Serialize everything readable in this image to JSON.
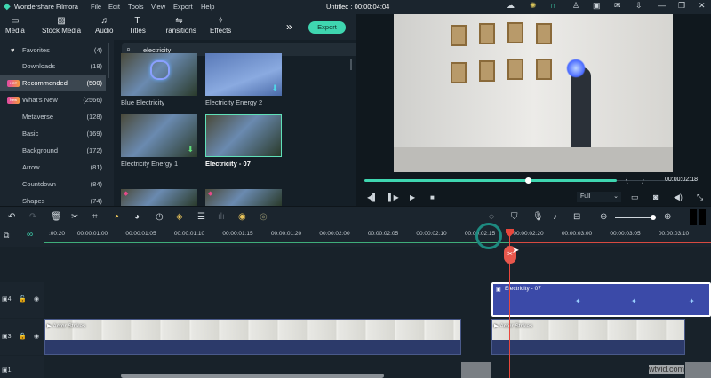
{
  "app": {
    "name": "Wondershare Filmora",
    "title": "Untitled : 00:00:04:04",
    "menu": [
      "File",
      "Edit",
      "Tools",
      "View",
      "Export",
      "Help"
    ]
  },
  "window_icons": [
    "cloud-icon",
    "lightbulb-icon",
    "headset-icon",
    "account-icon",
    "save-icon",
    "mail-icon",
    "download-icon",
    "minimize-icon",
    "restore-icon",
    "close-icon"
  ],
  "toolbar": {
    "tabs": [
      "Media",
      "Stock Media",
      "Audio",
      "Titles",
      "Transitions",
      "Effects"
    ],
    "more": "»",
    "export": "Export"
  },
  "sidebar": {
    "items": [
      {
        "label": "Favorites",
        "count": "(4)",
        "icon": "heart-icon"
      },
      {
        "label": "Downloads",
        "count": "(18)"
      },
      {
        "label": "Recommended",
        "count": "(500)",
        "badge": "HOT",
        "selected": true
      },
      {
        "label": "What's New",
        "count": "(2566)",
        "badge": "New"
      },
      {
        "label": "Metaverse",
        "count": "(128)"
      },
      {
        "label": "Basic",
        "count": "(169)"
      },
      {
        "label": "Background",
        "count": "(172)"
      },
      {
        "label": "Arrow",
        "count": "(81)"
      },
      {
        "label": "Countdown",
        "count": "(84)"
      },
      {
        "label": "Shapes",
        "count": "(74)"
      }
    ]
  },
  "search": {
    "value": "electricity"
  },
  "effects": [
    {
      "name": "Blue Electricity"
    },
    {
      "name": "Electricity Energy 2"
    },
    {
      "name": "Electricity Energy 1"
    },
    {
      "name": "Electricity - 07"
    }
  ],
  "player": {
    "progress": 0.67,
    "timecode": "00:00:02:18",
    "quality": "Full",
    "mark_in": "{",
    "mark_out": "}"
  },
  "ruler": {
    "labels": [
      ":00:20",
      "00:00:01:00",
      "00:00:01:05",
      "00:00:01:10",
      "00:00:01:15",
      "00:00:01:20",
      "00:00:02:00",
      "00:00:02:05",
      "00:00:02:10",
      "00:00:02:15",
      "00:00:02:20",
      "00:00:03:00",
      "00:00:03:05",
      "00:00:03:10"
    ]
  },
  "tracks": {
    "track4": "4",
    "track3": "3",
    "track1": "1"
  },
  "clips": {
    "effect": "Electricity - 07",
    "video1": "Actor Strikes",
    "video2": "Actor Strikes"
  },
  "watermark": "wtvid.com",
  "colors": {
    "accent": "#3fd6b0",
    "playhead": "#e8473c",
    "clip_effect": "#3b4aa8"
  }
}
